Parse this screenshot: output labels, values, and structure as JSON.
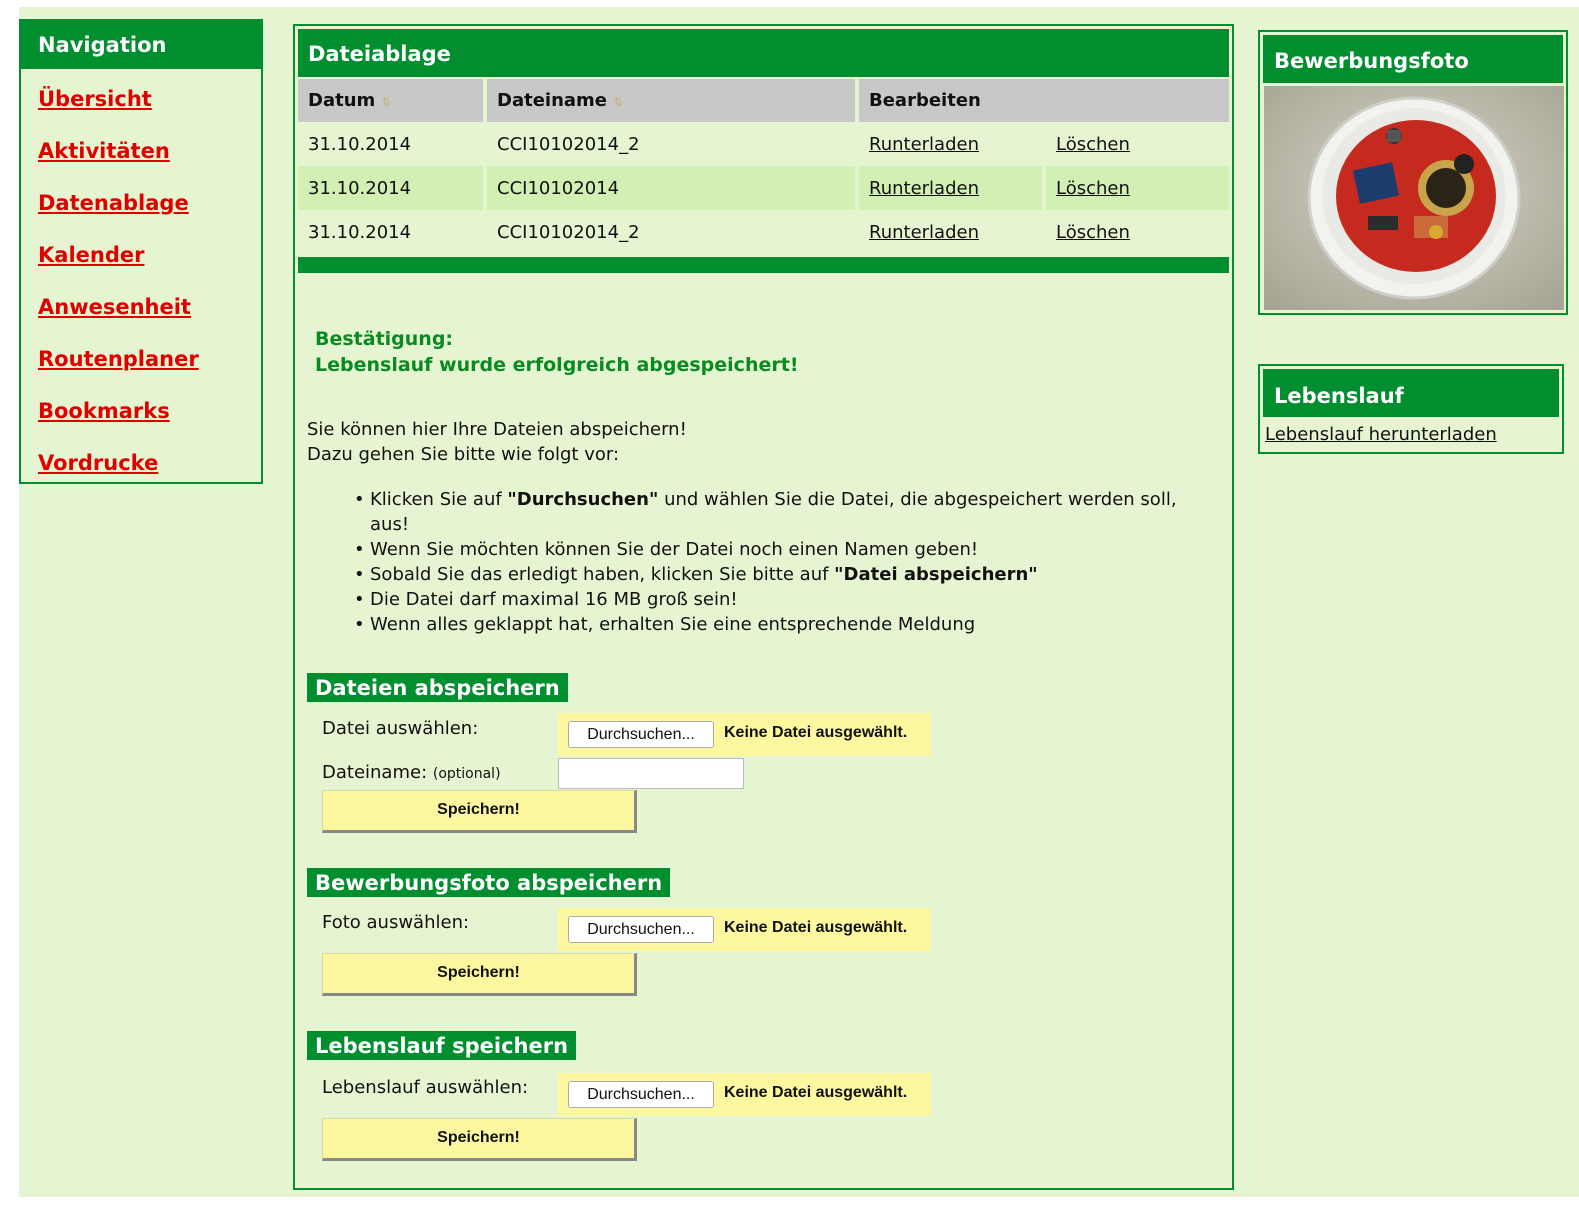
{
  "nav": {
    "title": "Navigation",
    "items": [
      {
        "label": "Übersicht"
      },
      {
        "label": "Aktivitäten"
      },
      {
        "label": "Datenablage"
      },
      {
        "label": "Kalender"
      },
      {
        "label": "Anwesenheit"
      },
      {
        "label": "Routenplaner"
      },
      {
        "label": "Bookmarks"
      },
      {
        "label": "Vordrucke"
      }
    ]
  },
  "files": {
    "title": "Dateiablage",
    "columns": {
      "date": "Datum",
      "name": "Dateiname",
      "edit": "Bearbeiten"
    },
    "rows": [
      {
        "date": "31.10.2014",
        "name": "CCI10102014_2",
        "download": "Runterladen",
        "delete": "Löschen"
      },
      {
        "date": "31.10.2014",
        "name": "CCI10102014",
        "download": "Runterladen",
        "delete": "Löschen"
      },
      {
        "date": "31.10.2014",
        "name": "CCI10102014_2",
        "download": "Runterladen",
        "delete": "Löschen"
      }
    ]
  },
  "confirmation": {
    "title": "Bestätigung:",
    "message": "Lebenslauf wurde erfolgreich abgespeichert!"
  },
  "instructions": {
    "line1": "Sie können hier Ihre Dateien abspeichern!",
    "line2": "Dazu gehen Sie bitte wie folgt vor:",
    "steps": [
      {
        "pre": "Klicken Sie auf ",
        "bold": "\"Durchsuchen\"",
        "post": " und wählen Sie die Datei, die abgespeichert werden soll, aus!"
      },
      {
        "pre": "Wenn Sie möchten können Sie der Datei noch einen Namen geben!",
        "bold": "",
        "post": ""
      },
      {
        "pre": "Sobald Sie das erledigt haben, klicken Sie bitte auf ",
        "bold": "\"Datei abspeichern\"",
        "post": ""
      },
      {
        "pre": "Die Datei darf maximal 16 MB groß sein!",
        "bold": "",
        "post": ""
      },
      {
        "pre": "Wenn alles geklappt hat, erhalten Sie eine entsprechende Meldung",
        "bold": "",
        "post": ""
      }
    ]
  },
  "upload_files": {
    "title": "Dateien abspeichern",
    "file_label": "Datei auswählen:",
    "name_label": "Dateiname:",
    "name_hint": "(optional)",
    "name_value": "",
    "browse": "Durchsuchen...",
    "no_file": "Keine Datei ausgewählt.",
    "save": "Speichern!"
  },
  "upload_photo": {
    "title": "Bewerbungsfoto abspeichern",
    "file_label": "Foto auswählen:",
    "browse": "Durchsuchen...",
    "no_file": "Keine Datei ausgewählt.",
    "save": "Speichern!"
  },
  "upload_cv": {
    "title": "Lebenslauf speichern",
    "file_label": "Lebenslauf auswählen:",
    "browse": "Durchsuchen...",
    "no_file": "Keine Datei ausgewählt.",
    "save": "Speichern!"
  },
  "photo_box": {
    "title": "Bewerbungsfoto"
  },
  "cv_box": {
    "title": "Lebenslauf",
    "link": "Lebenslauf herunterladen"
  },
  "colors": {
    "accent": "#008e2f",
    "background": "#e6f5d1",
    "link_red": "#e00000",
    "button_yellow": "#fdf8a0"
  }
}
